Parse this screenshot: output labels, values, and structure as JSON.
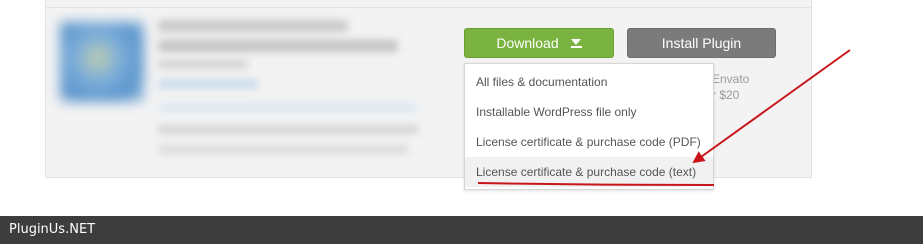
{
  "buttons": {
    "download_label": "Download",
    "install_label": "Install Plugin"
  },
  "side_note": {
    "line1": "Envato",
    "line2": "r $20"
  },
  "download_menu": {
    "items": [
      "All files & documentation",
      "Installable WordPress file only",
      "License certificate & purchase code (PDF)",
      "License certificate & purchase code (text)"
    ],
    "highlighted_index": 3
  },
  "footer": {
    "text": "PluginUs.NET"
  },
  "colors": {
    "download_button": "#7ab33f",
    "install_button": "#7b7b7b",
    "annotation": "#c8151b",
    "footer_bar": "#3d3d3d"
  },
  "icons": {
    "download_caret": "arrow-down-to-line-icon"
  }
}
